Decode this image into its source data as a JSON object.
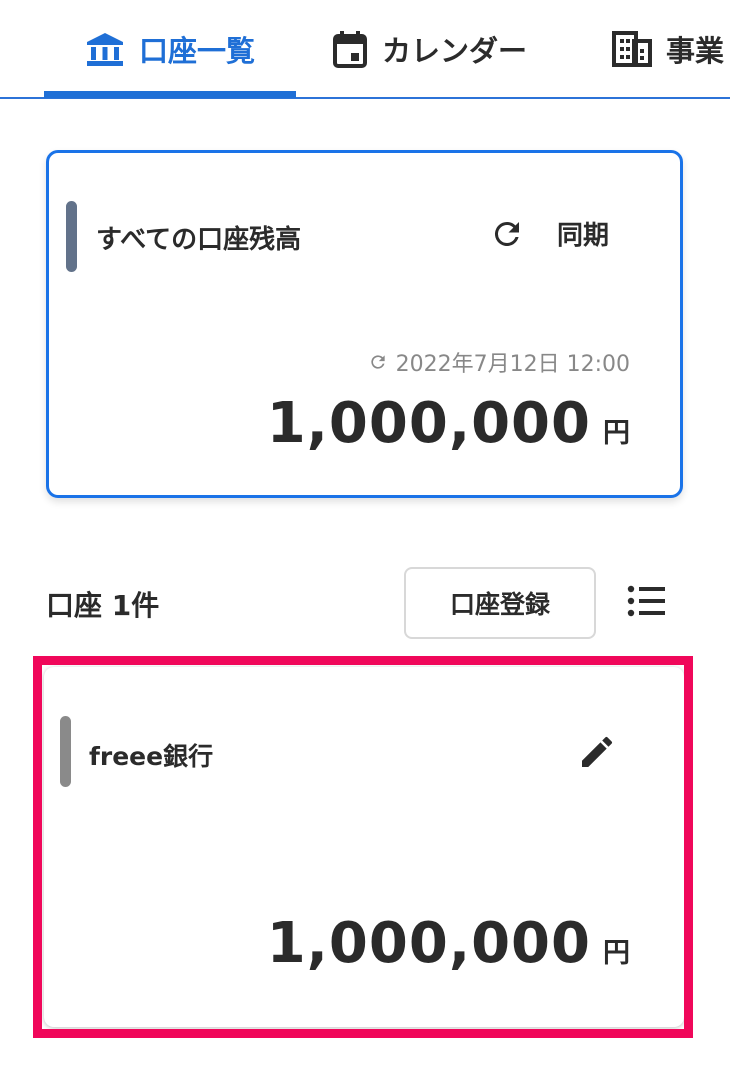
{
  "tabs": [
    {
      "label": "口座一覧",
      "icon": "bank-icon",
      "active": true
    },
    {
      "label": "カレンダー",
      "icon": "calendar-icon",
      "active": false
    },
    {
      "label": "事業",
      "icon": "office-building-icon",
      "active": false
    }
  ],
  "total_card": {
    "title": "すべての口座残高",
    "sync_label": "同期",
    "sync_icon": "refresh-icon",
    "last_updated": "2022年7月12日 12:00",
    "amount": "1,000,000",
    "currency": "円"
  },
  "accounts_section": {
    "count_label": "口座 1件",
    "register_label": "口座登録",
    "list_view_icon": "list-icon"
  },
  "accounts": [
    {
      "name": "freee銀行",
      "amount": "1,000,000",
      "currency": "円",
      "edit_icon": "pencil-icon"
    }
  ],
  "colors": {
    "primary": "#1f6fd6",
    "card_border": "#1a73e8",
    "highlight": "#f0075a",
    "total_accent": "#62728a",
    "account_accent": "#8a8a8a"
  }
}
